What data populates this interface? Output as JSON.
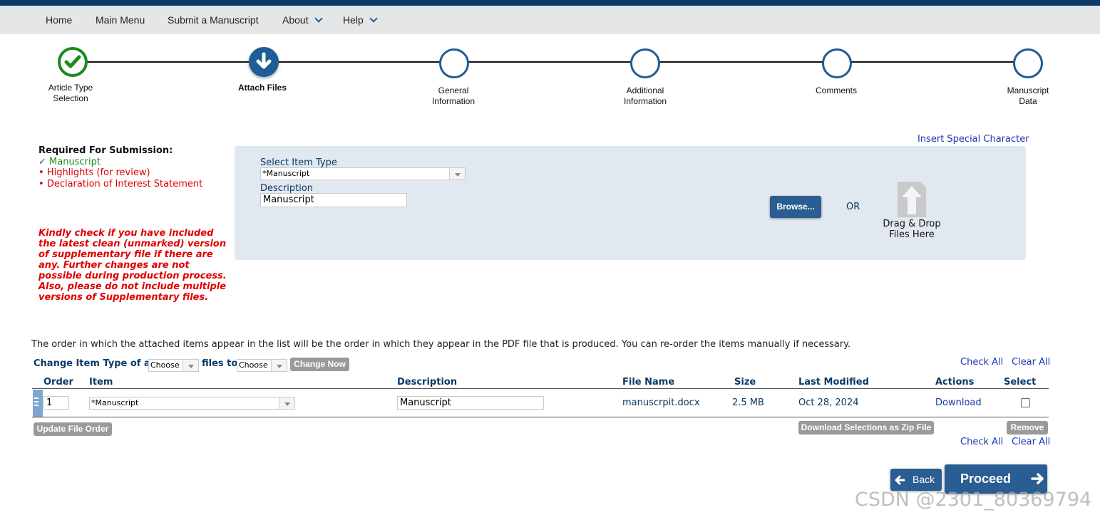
{
  "nav": {
    "home": "Home",
    "main_menu": "Main Menu",
    "submit": "Submit a Manuscript",
    "about": "About",
    "help": "Help"
  },
  "steps": [
    {
      "line1": "Article Type",
      "line2": "Selection",
      "state": "done"
    },
    {
      "line1": "Attach Files",
      "line2": "",
      "state": "current"
    },
    {
      "line1": "General",
      "line2": "Information",
      "state": "pending"
    },
    {
      "line1": "Additional",
      "line2": "Information",
      "state": "pending"
    },
    {
      "line1": "Comments",
      "line2": "",
      "state": "pending"
    },
    {
      "line1": "Manuscript",
      "line2": "Data",
      "state": "pending"
    }
  ],
  "required": {
    "title": "Required For Submission:",
    "items": [
      {
        "text": "Manuscript",
        "done": true
      },
      {
        "text": "Highlights (for review)",
        "done": false
      },
      {
        "text": "Declaration of Interest Statement",
        "done": false
      }
    ]
  },
  "note": "Kindly check if you have included the latest clean (unmarked) version of supplementary file if there are any. Further changes are not possible during production process. Also, please do not include multiple versions of Supplementary files.",
  "upload": {
    "insert_special": "Insert Special Character",
    "select_item_type_label": "Select Item Type",
    "select_item_type_value": "*Manuscript",
    "description_label": "Description",
    "description_value": "Manuscript",
    "browse_label": "Browse...",
    "or_label": "OR",
    "drag_line1": "Drag & Drop",
    "drag_line2": "Files Here"
  },
  "order_note": "The order in which the attached items appear in the list will be the order in which they appear in the PDF file that is produced. You can re-order the items manually if necessary.",
  "change_type": {
    "label_prefix": "Change Item Type of all",
    "choose1": "Choose",
    "label_mid": "files to",
    "choose2": "Choose",
    "button": "Change Now"
  },
  "links": {
    "check_all": "Check All",
    "clear_all": "Clear All"
  },
  "table": {
    "headers": {
      "order": "Order",
      "item": "Item",
      "description": "Description",
      "file_name": "File Name",
      "size": "Size",
      "last_modified": "Last Modified",
      "actions": "Actions",
      "select": "Select"
    },
    "rows": [
      {
        "order": "1",
        "item": "*Manuscript",
        "description": "Manuscript",
        "file_name": "manuscrpit.docx",
        "size": "2.5 MB",
        "last_modified": "Oct 28, 2024",
        "action": "Download"
      }
    ]
  },
  "buttons": {
    "update_order": "Update File Order",
    "download_zip": "Download Selections as Zip File",
    "remove": "Remove",
    "back": "Back",
    "proceed": "Proceed"
  },
  "watermark": "CSDN @2301_80369794",
  "colors": {
    "brand_navy": "#0a3a66",
    "step_blue": "#1f5d96",
    "done_green": "#1c8a1c",
    "alert_red": "#e00000",
    "panel_bg": "#e1e8ef"
  }
}
